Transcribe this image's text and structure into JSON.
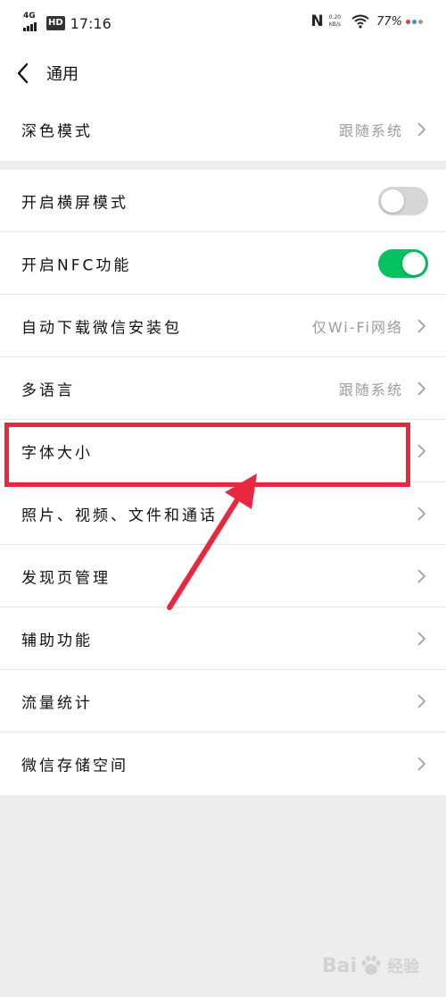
{
  "status_bar": {
    "network": "4G",
    "hd": "HD",
    "time": "17:16",
    "nfc": "N",
    "speed_value": "0.20",
    "speed_unit": "KB/s",
    "battery": "77%",
    "notification_dot_colors": [
      "#e23b3b",
      "#3c8fd8",
      "#9a9a9a"
    ]
  },
  "header": {
    "back_icon": "chevron-left-icon",
    "title": "通用"
  },
  "group1": [
    {
      "label": "深色模式",
      "value": "跟随系统",
      "control": "chevron"
    }
  ],
  "group2": [
    {
      "label": "开启横屏模式",
      "control": "toggle",
      "toggle_on": false
    },
    {
      "label": "开启NFC功能",
      "control": "toggle",
      "toggle_on": true
    },
    {
      "label": "自动下载微信安装包",
      "value": "仅Wi-Fi网络",
      "control": "chevron"
    },
    {
      "label": "多语言",
      "value": "跟随系统",
      "control": "chevron"
    },
    {
      "label": "字体大小",
      "value": "",
      "control": "chevron"
    },
    {
      "label": "照片、视频、文件和通话",
      "value": "",
      "control": "chevron"
    },
    {
      "label": "发现页管理",
      "value": "",
      "control": "chevron"
    },
    {
      "label": "辅助功能",
      "value": "",
      "control": "chevron"
    },
    {
      "label": "流量统计",
      "value": "",
      "control": "chevron"
    },
    {
      "label": "微信存储空间",
      "value": "",
      "control": "chevron"
    }
  ],
  "annotation": {
    "highlight_color": "#e8283f",
    "highlighted_item": "字体大小"
  },
  "watermark": {
    "text1": "Bai",
    "text2": "经验"
  },
  "colors": {
    "toggle_on": "#07c160",
    "toggle_off": "#d6d6d6",
    "page_background": "#ededed"
  }
}
